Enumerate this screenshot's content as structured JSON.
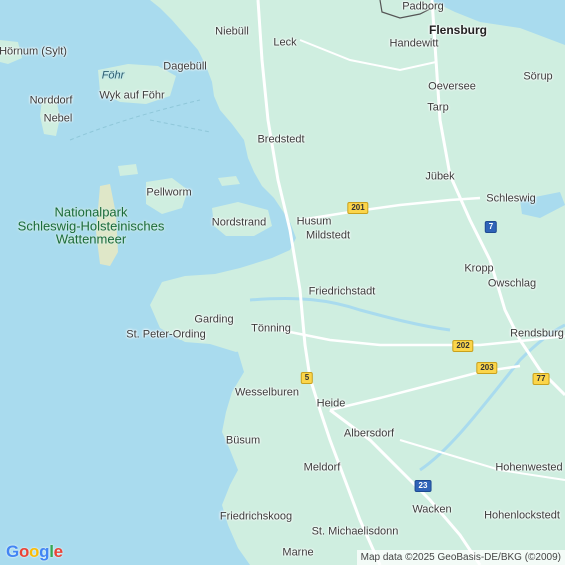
{
  "map": {
    "colors": {
      "water": "#a9dbee",
      "land": "#cfeee0",
      "road": "#ffffff",
      "highway": "#fbd54a"
    },
    "places": [
      {
        "id": "padborg",
        "label": "Padborg",
        "kind": "town"
      },
      {
        "id": "flensburg",
        "label": "Flensburg",
        "kind": "city"
      },
      {
        "id": "niebull",
        "label": "Niebüll",
        "kind": "town"
      },
      {
        "id": "leck",
        "label": "Leck",
        "kind": "town"
      },
      {
        "id": "handewitt",
        "label": "Handewitt",
        "kind": "town"
      },
      {
        "id": "hornum",
        "label": "Hörnum (Sylt)",
        "kind": "town"
      },
      {
        "id": "fohr",
        "label": "Föhr",
        "kind": "island"
      },
      {
        "id": "dagebull",
        "label": "Dagebüll",
        "kind": "town"
      },
      {
        "id": "sorup",
        "label": "Sörup",
        "kind": "town"
      },
      {
        "id": "oeversee",
        "label": "Oeversee",
        "kind": "town"
      },
      {
        "id": "norddorf",
        "label": "Norddorf",
        "kind": "town"
      },
      {
        "id": "wyk",
        "label": "Wyk auf Föhr",
        "kind": "town"
      },
      {
        "id": "tarp",
        "label": "Tarp",
        "kind": "town"
      },
      {
        "id": "nebel",
        "label": "Nebel",
        "kind": "town"
      },
      {
        "id": "bredstedt",
        "label": "Bredstedt",
        "kind": "town"
      },
      {
        "id": "jubek",
        "label": "Jübek",
        "kind": "town"
      },
      {
        "id": "pellworm",
        "label": "Pellworm",
        "kind": "town"
      },
      {
        "id": "schleswig",
        "label": "Schleswig",
        "kind": "town"
      },
      {
        "id": "nordstrand",
        "label": "Nordstrand",
        "kind": "town"
      },
      {
        "id": "husum",
        "label": "Husum",
        "kind": "town"
      },
      {
        "id": "mildstedt",
        "label": "Mildstedt",
        "kind": "town"
      },
      {
        "id": "kropp",
        "label": "Kropp",
        "kind": "town"
      },
      {
        "id": "owschlag",
        "label": "Owschlag",
        "kind": "town"
      },
      {
        "id": "friedrichstadt",
        "label": "Friedrichstadt",
        "kind": "town"
      },
      {
        "id": "garding",
        "label": "Garding",
        "kind": "town"
      },
      {
        "id": "tonning",
        "label": "Tönning",
        "kind": "town"
      },
      {
        "id": "rendsburg",
        "label": "Rendsburg",
        "kind": "town"
      },
      {
        "id": "st-peter",
        "label": "St. Peter-Ording",
        "kind": "town"
      },
      {
        "id": "wesselburen",
        "label": "Wesselburen",
        "kind": "town"
      },
      {
        "id": "heide",
        "label": "Heide",
        "kind": "town"
      },
      {
        "id": "albersdorf",
        "label": "Albersdorf",
        "kind": "town"
      },
      {
        "id": "busum",
        "label": "Büsum",
        "kind": "town"
      },
      {
        "id": "hohenwestedt",
        "label": "Hohenwested",
        "kind": "town"
      },
      {
        "id": "meldorf",
        "label": "Meldorf",
        "kind": "town"
      },
      {
        "id": "wacken",
        "label": "Wacken",
        "kind": "town"
      },
      {
        "id": "friedrichskoog",
        "label": "Friedrichskoog",
        "kind": "town"
      },
      {
        "id": "hohenlockstedt",
        "label": "Hohenlockstedt",
        "kind": "town"
      },
      {
        "id": "st-michaelisdonn",
        "label": "St. Michaelisdonn",
        "kind": "town"
      },
      {
        "id": "marne",
        "label": "Marne",
        "kind": "town"
      }
    ],
    "park_label_lines": [
      "Nationalpark",
      "Schleswig-Holsteinisches",
      "Wattenmeer"
    ],
    "road_shields": [
      {
        "id": "r201",
        "number": "201",
        "style": "yellow"
      },
      {
        "id": "a7",
        "number": "7",
        "style": "blue"
      },
      {
        "id": "r202",
        "number": "202",
        "style": "yellow"
      },
      {
        "id": "r203",
        "number": "203",
        "style": "yellow"
      },
      {
        "id": "r77",
        "number": "77",
        "style": "yellow"
      },
      {
        "id": "r5",
        "number": "5",
        "style": "yellow"
      },
      {
        "id": "a23",
        "number": "23",
        "style": "blue"
      }
    ]
  },
  "logo": {
    "text": "Google",
    "letter_colors": [
      "#4285F4",
      "#EA4335",
      "#FBBC05",
      "#4285F4",
      "#34A853",
      "#EA4335"
    ]
  },
  "attribution": "Map data ©2025 GeoBasis-DE/BKG (©2009)"
}
